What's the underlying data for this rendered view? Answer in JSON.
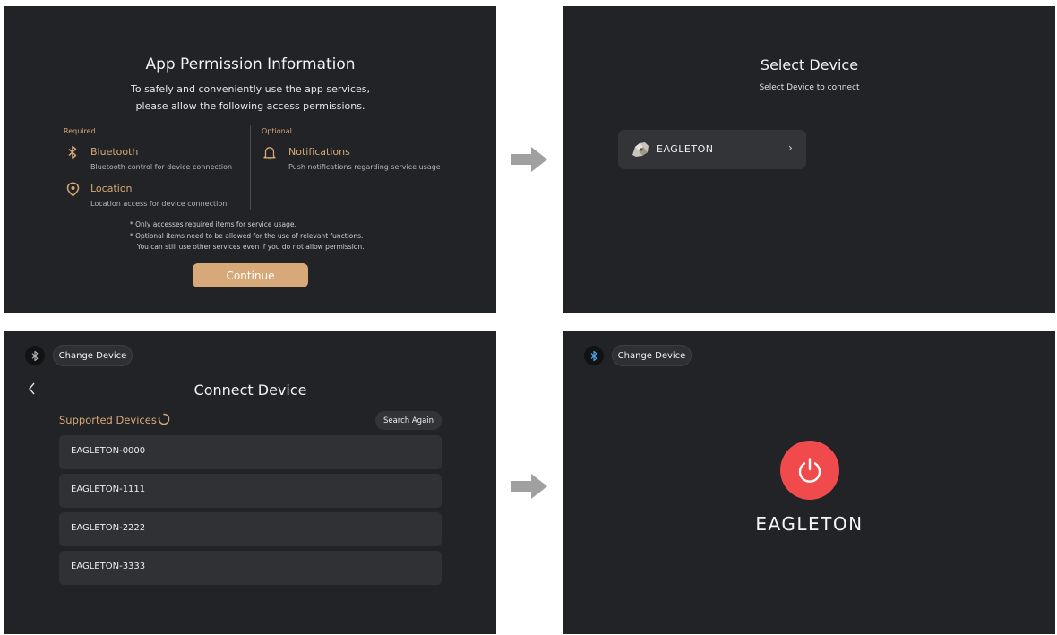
{
  "colors": {
    "panel_bg": "#222327",
    "accent": "#d6a874",
    "button": "#d7a878",
    "power": "#f04a4c",
    "bluetooth_active": "#4aa8e8"
  },
  "permission_screen": {
    "title": "App Permission Information",
    "description_line1": "To safely and conveniently use the app services,",
    "description_line2": "please allow the following access permissions.",
    "required_label": "Required",
    "optional_label": "Optional",
    "required_items": [
      {
        "icon": "bluetooth-icon",
        "name": "Bluetooth",
        "desc": "Bluetooth control for device connection"
      },
      {
        "icon": "location-icon",
        "name": "Location",
        "desc": "Location access for device connection"
      }
    ],
    "optional_items": [
      {
        "icon": "bell-icon",
        "name": "Notifications",
        "desc": "Push notifications regarding service usage"
      }
    ],
    "notes": [
      "* Only accesses required items for service usage.",
      "* Optional items need to be allowed for the use of relevant functions.",
      "You can still use other services even if you do not allow permission."
    ],
    "continue_label": "Continue"
  },
  "select_screen": {
    "title": "Select Device",
    "subtitle": "Select Device to connect",
    "device_name": "EAGLETON",
    "chevron": "›"
  },
  "connect_screen": {
    "change_device_label": "Change Device",
    "title": "Connect Device",
    "supported_label": "Supported Devices",
    "search_again_label": "Search Again",
    "devices": [
      "EAGLETON-0000",
      "EAGLETON-1111",
      "EAGLETON-2222",
      "EAGLETON-3333"
    ]
  },
  "connected_screen": {
    "change_device_label": "Change Device",
    "device_name": "EAGLETON"
  }
}
